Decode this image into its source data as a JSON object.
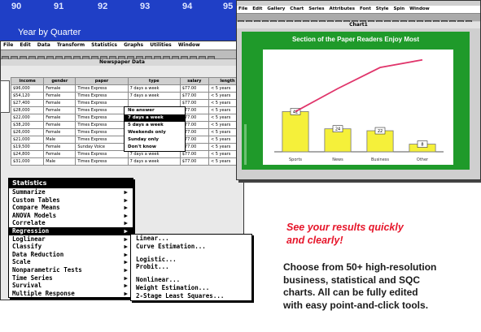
{
  "back_window": {
    "axis_ticks": [
      "90",
      "91",
      "92",
      "93",
      "94",
      "95"
    ],
    "title": "Year by Quarter"
  },
  "sheet": {
    "menu": [
      "File",
      "Edit",
      "Data",
      "Transform",
      "Statistics",
      "Graphs",
      "Utilities",
      "Window"
    ],
    "data_title": "Newspaper Data",
    "columns": [
      "income",
      "gender",
      "paper",
      "type",
      "salary",
      "length"
    ],
    "rows": [
      [
        "$96,000",
        "Female",
        "Times Express",
        "7 days a week",
        "$77.00",
        "< 5 years"
      ],
      [
        "$54,120",
        "Female",
        "Times Express",
        "7 days a week",
        "$77.00",
        "< 5 years"
      ],
      [
        "$27,400",
        "Female",
        "Times Express",
        "",
        "$77.00",
        "< 5 years"
      ],
      [
        "$28,000",
        "Female",
        "Times Express",
        "",
        "$77.00",
        "< 5 years"
      ],
      [
        "$22,000",
        "Female",
        "Times Express",
        "",
        "$77.00",
        "< 5 years"
      ],
      [
        "$38,200",
        "Female",
        "Times Express",
        "",
        "$77.00",
        "< 5 years"
      ],
      [
        "$26,000",
        "Female",
        "Times Express",
        "",
        "$77.00",
        "< 5 years"
      ],
      [
        "$21,000",
        "Male",
        "Times Express",
        "",
        "$77.00",
        "< 5 years"
      ],
      [
        "$19,500",
        "Female",
        "Sunday Voice",
        "7 days a week",
        "$77.00",
        "< 5 years"
      ],
      [
        "$24,800",
        "Female",
        "Times Express",
        "7 days a week",
        "$77.00",
        "< 5 years"
      ],
      [
        "$31,000",
        "Male",
        "Times Express",
        "7 days a week",
        "$77.00",
        "< 5 years"
      ]
    ],
    "dropdown": [
      "No answer",
      "7 days a week",
      "5 days a week",
      "Weekends only",
      "Sunday only",
      "Don't know"
    ],
    "dropdown_selected": "7 days a week"
  },
  "stat_menu": {
    "title": "Statistics",
    "items": [
      {
        "label": "Summarize",
        "arrow": "▶"
      },
      {
        "label": "Custom Tables",
        "arrow": "▶"
      },
      {
        "label": "Compare Means",
        "arrow": "▶"
      },
      {
        "label": "ANOVA Models",
        "arrow": "▶"
      },
      {
        "label": "Correlate",
        "arrow": "▶"
      },
      {
        "label": "Regression",
        "arrow": "▶"
      },
      {
        "label": "Loglinear",
        "arrow": "▶"
      },
      {
        "label": "Classify",
        "arrow": "▶"
      },
      {
        "label": "Data Reduction",
        "arrow": "▶"
      },
      {
        "label": "Scale",
        "arrow": "▶"
      },
      {
        "label": "Nonparametric Tests",
        "arrow": "▶"
      },
      {
        "label": "Time Series",
        "arrow": "▶"
      },
      {
        "label": "Survival",
        "arrow": "▶"
      },
      {
        "label": "Multiple Response",
        "arrow": "▶"
      }
    ],
    "highlighted": "Regression"
  },
  "regression_submenu": {
    "group1": [
      "Linear...",
      "Curve Estimation..."
    ],
    "group2": [
      "Logistic...",
      "Probit..."
    ],
    "group3": [
      "Nonlinear...",
      "Weight Estimation...",
      "2-Stage Least Squares..."
    ]
  },
  "chart_window": {
    "menu": [
      "File",
      "Edit",
      "Gallery",
      "Chart",
      "Series",
      "Attributes",
      "Font",
      "Style",
      "Spin",
      "Window"
    ],
    "title": "Chart1"
  },
  "chart_data": {
    "type": "bar",
    "title": "Section of the Paper Readers Enjoy Most",
    "categories": [
      "Sports",
      "News",
      "Business",
      "Other"
    ],
    "values": [
      42,
      24,
      22,
      8
    ],
    "value_labels": [
      "42",
      "24",
      "22",
      "8"
    ],
    "cumulative_line": [
      42,
      66,
      88,
      96
    ],
    "ylim": [
      0,
      100
    ],
    "colors": {
      "bars": "#f5f03a",
      "line": "#e0356b",
      "frame": "#1f9a2a"
    }
  },
  "marketing": {
    "headline_line1": "See your results quickly",
    "headline_line2": "and clearly!",
    "body_line1": "Choose from 50+ high-resolution",
    "body_line2": "business, statistical and SQC",
    "body_line3": "charts. All can be fully edited",
    "body_line4": "with easy point-and-click tools."
  }
}
